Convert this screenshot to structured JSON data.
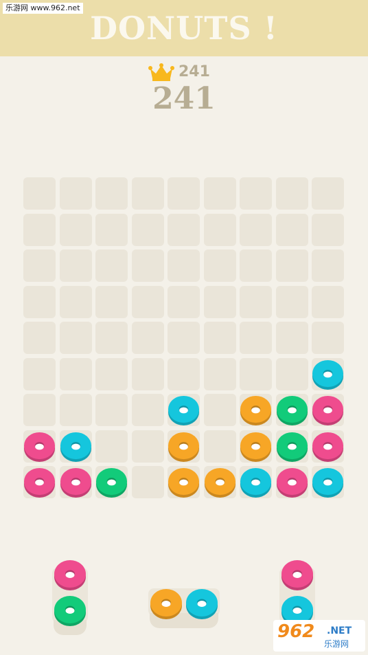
{
  "watermark": "乐游网 www.962.net",
  "title": "DONUTS !",
  "best_score": "241",
  "score": "241",
  "colors": {
    "pink": "#ef4c8e",
    "blue": "#15c6dd",
    "orange": "#f7a626",
    "green": "#12cb7a"
  },
  "grid": {
    "rows": [
      [
        null,
        null,
        null,
        null,
        null,
        null,
        null,
        null,
        null
      ],
      [
        null,
        null,
        null,
        null,
        null,
        null,
        null,
        null,
        null
      ],
      [
        null,
        null,
        null,
        null,
        null,
        null,
        null,
        null,
        null
      ],
      [
        null,
        null,
        null,
        null,
        null,
        null,
        null,
        null,
        null
      ],
      [
        null,
        null,
        null,
        null,
        null,
        null,
        null,
        null,
        null
      ],
      [
        null,
        null,
        null,
        null,
        null,
        null,
        null,
        null,
        "blue"
      ],
      [
        null,
        null,
        null,
        null,
        "blue",
        null,
        "orange",
        "green",
        "pink"
      ],
      [
        "pink",
        "blue",
        null,
        null,
        "orange",
        null,
        "orange",
        "green",
        "pink"
      ],
      [
        "pink",
        "pink",
        "green",
        null,
        "orange",
        "orange",
        "blue",
        "pink",
        "blue"
      ]
    ]
  },
  "pieces": [
    {
      "orientation": "vertical",
      "donuts": [
        "pink",
        "green"
      ]
    },
    {
      "orientation": "horizontal",
      "donuts": [
        "orange",
        "blue"
      ]
    },
    {
      "orientation": "vertical",
      "donuts": [
        "pink",
        "blue"
      ]
    }
  ],
  "logo": {
    "number": "962",
    "suffix": ".NET",
    "text": "乐游网"
  }
}
